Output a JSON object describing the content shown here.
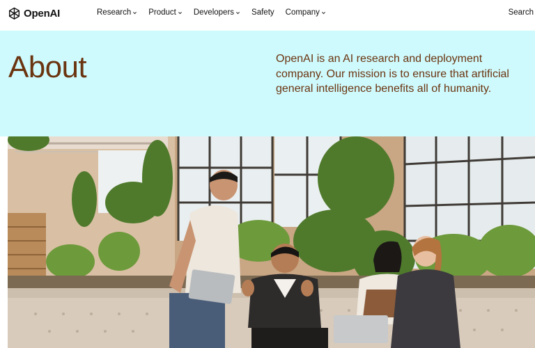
{
  "nav": {
    "logo_text": "OpenAI",
    "items": [
      {
        "label": "Research",
        "has_dropdown": true
      },
      {
        "label": "Product",
        "has_dropdown": true
      },
      {
        "label": "Developers",
        "has_dropdown": true
      },
      {
        "label": "Safety",
        "has_dropdown": false
      },
      {
        "label": "Company",
        "has_dropdown": true
      }
    ],
    "search_label": "Search"
  },
  "hero": {
    "title": "About",
    "description": "OpenAI is an AI research and deployment company. Our mission is to ensure that artificial general intelligence benefits all of humanity.",
    "background_color": "#cefafd",
    "text_color": "#6b3410"
  },
  "photo": {
    "subject": "office-team-photo"
  }
}
